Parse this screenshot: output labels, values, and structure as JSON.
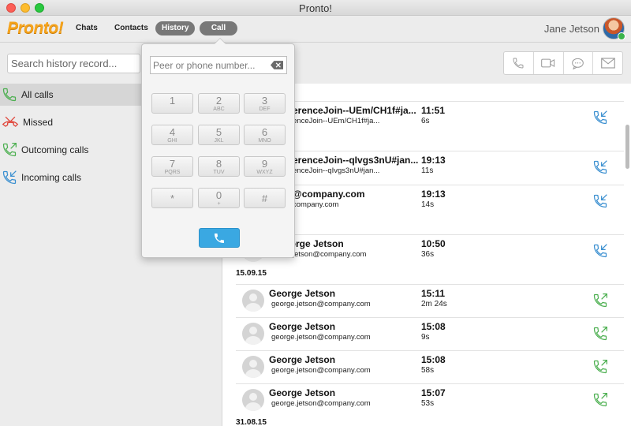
{
  "window": {
    "title": "Pronto!"
  },
  "app": {
    "logo_text": "Pronto!"
  },
  "nav": {
    "items": [
      {
        "label": "Chats",
        "active": false
      },
      {
        "label": "Contacts",
        "active": false
      },
      {
        "label": "History",
        "active": true
      },
      {
        "label": "Call",
        "active": true
      }
    ]
  },
  "user": {
    "name": "Jane Jetson",
    "status": "online"
  },
  "search": {
    "placeholder": "Search history record...",
    "value": ""
  },
  "actions": [
    "phone-icon",
    "video-icon",
    "chat-icon",
    "mail-icon"
  ],
  "sidebar": {
    "items": [
      {
        "label": "All calls",
        "icon": "all-calls-icon",
        "selected": true
      },
      {
        "label": "Missed",
        "icon": "missed-call-icon",
        "selected": false
      },
      {
        "label": "Outcoming calls",
        "icon": "outgoing-call-icon",
        "selected": false
      },
      {
        "label": "Incoming calls",
        "icon": "incoming-call-icon",
        "selected": false
      }
    ]
  },
  "dialpad": {
    "placeholder": "Peer or phone number...",
    "keys": [
      {
        "digit": "1",
        "letters": ""
      },
      {
        "digit": "2",
        "letters": "ABC"
      },
      {
        "digit": "3",
        "letters": "DEF"
      },
      {
        "digit": "4",
        "letters": "GHI"
      },
      {
        "digit": "5",
        "letters": "JKL"
      },
      {
        "digit": "6",
        "letters": "MNO"
      },
      {
        "digit": "7",
        "letters": "PQRS"
      },
      {
        "digit": "8",
        "letters": "TUV"
      },
      {
        "digit": "9",
        "letters": "WXYZ"
      },
      {
        "digit": "*",
        "letters": ""
      },
      {
        "digit": "0",
        "letters": "+"
      },
      {
        "digit": "#",
        "letters": ""
      }
    ]
  },
  "history": {
    "dates": [
      "15.09.15",
      "31.08.15"
    ],
    "calls": [
      {
        "name": "erenceJoin--UEm/CH1f#ja...",
        "sub": "enceJoin--UEm/CH1f#ja...",
        "time": "11:51",
        "duration": "6s",
        "direction": "incoming"
      },
      {
        "name": "erenceJoin--qIvgs3nU#jan...",
        "sub": "enceJoin--qIvgs3nU#jan...",
        "time": "19:13",
        "duration": "11s",
        "direction": "incoming"
      },
      {
        "name": "@company.com",
        "sub": "company.com",
        "time": "19:13",
        "duration": "14s",
        "direction": "incoming"
      },
      {
        "name": "eorge Jetson",
        "sub": "jetson@company.com",
        "time": "10:50",
        "duration": "36s",
        "direction": "incoming"
      },
      {
        "name": "George Jetson",
        "sub": "george.jetson@company.com",
        "time": "15:11",
        "duration": "2m 24s",
        "direction": "outgoing"
      },
      {
        "name": "George Jetson",
        "sub": "george.jetson@company.com",
        "time": "15:08",
        "duration": "9s",
        "direction": "outgoing"
      },
      {
        "name": "George Jetson",
        "sub": "george.jetson@company.com",
        "time": "15:08",
        "duration": "58s",
        "direction": "outgoing"
      },
      {
        "name": "George Jetson",
        "sub": "george.jetson@company.com",
        "time": "15:07",
        "duration": "53s",
        "direction": "outgoing"
      }
    ]
  },
  "colors": {
    "accent": "#3aa8e2",
    "logo": "#f5a31c",
    "incoming": "#3a8fd0",
    "outgoing": "#4caf50",
    "missed": "#e0453a"
  }
}
